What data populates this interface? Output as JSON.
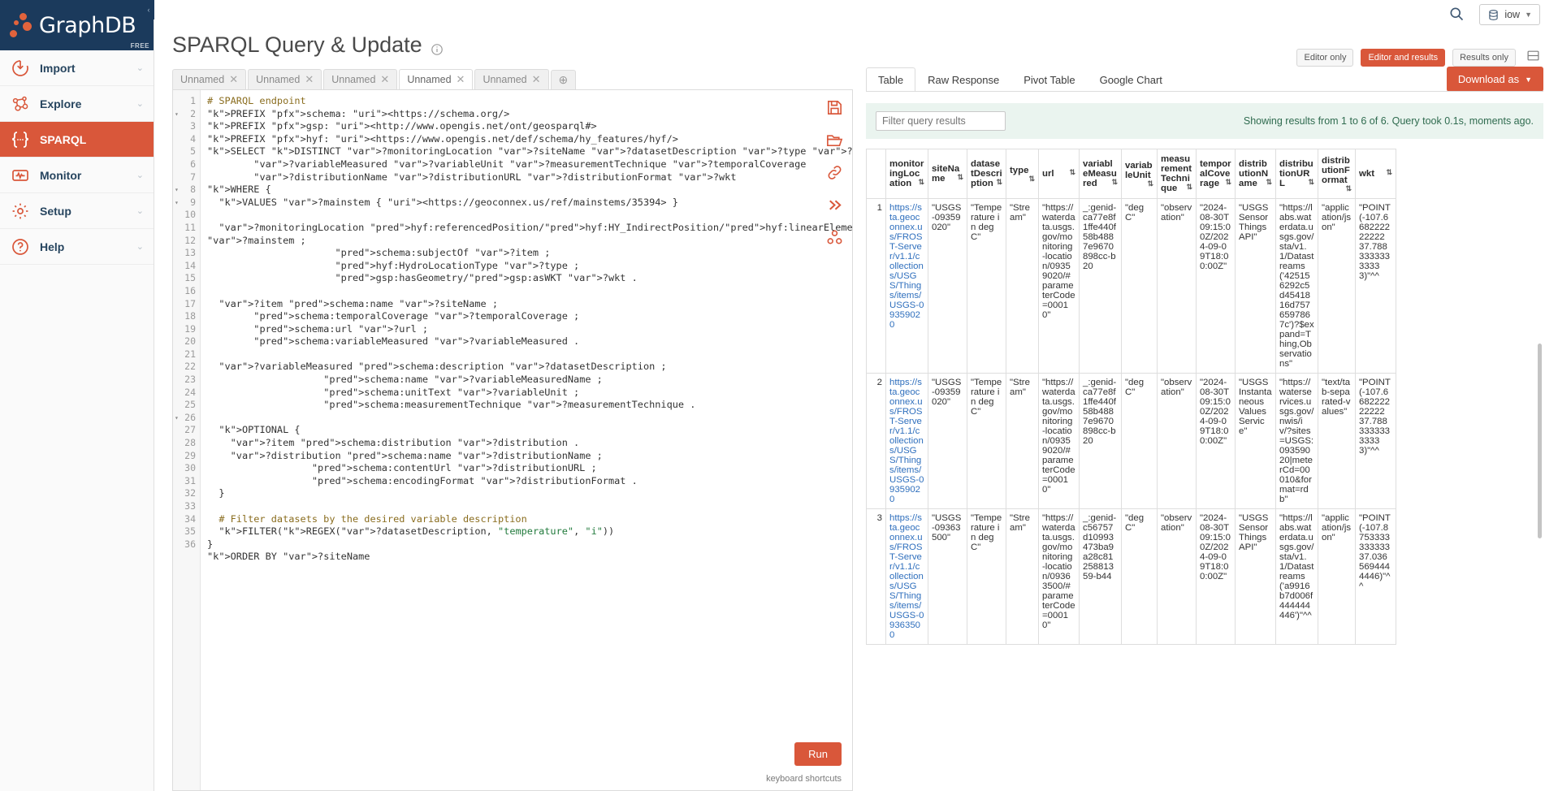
{
  "brand": {
    "name": "GraphDB",
    "edition": "FREE"
  },
  "sidebar": {
    "items": [
      {
        "label": "Import",
        "icon": "import-icon",
        "active": false
      },
      {
        "label": "Explore",
        "icon": "explore-icon",
        "active": false
      },
      {
        "label": "SPARQL",
        "icon": "sparql-icon",
        "active": true
      },
      {
        "label": "Monitor",
        "icon": "monitor-icon",
        "active": false
      },
      {
        "label": "Setup",
        "icon": "setup-icon",
        "active": false
      },
      {
        "label": "Help",
        "icon": "help-icon",
        "active": false
      }
    ]
  },
  "topbar": {
    "search_icon": "search-icon",
    "repository": "iow",
    "repo_icon": "database-icon",
    "repo_caret": "chevron-down-icon"
  },
  "page": {
    "title": "SPARQL Query & Update",
    "info_icon": "info-icon",
    "view_modes": [
      {
        "label": "Editor only",
        "selected": false
      },
      {
        "label": "Editor and results",
        "selected": true
      },
      {
        "label": "Results only",
        "selected": false
      }
    ],
    "layout_toggle_icon": "split-layout-icon"
  },
  "editor": {
    "tabs": [
      {
        "label": "Unnamed",
        "active": false
      },
      {
        "label": "Unnamed",
        "active": false
      },
      {
        "label": "Unnamed",
        "active": false
      },
      {
        "label": "Unnamed",
        "active": true
      },
      {
        "label": "Unnamed",
        "active": false
      }
    ],
    "add_tab_icon": "plus-circle-icon",
    "tools": [
      {
        "icon": "save-icon"
      },
      {
        "icon": "open-folder-icon"
      },
      {
        "icon": "link-icon"
      },
      {
        "icon": "double-chevron-right-icon"
      },
      {
        "icon": "graph-explore-icon"
      }
    ],
    "run_label": "Run",
    "keyboard_shortcuts_label": "keyboard shortcuts",
    "line_count": 36,
    "folded_lines": [
      2,
      8,
      9,
      26
    ],
    "query_lines": [
      "# SPARQL endpoint",
      "PREFIX schema: <https://schema.org/>",
      "PREFIX gsp: <http://www.opengis.net/ont/geosparql#>",
      "PREFIX hyf: <https://www.opengis.net/def/schema/hy_features/hyf/>",
      "SELECT DISTINCT ?monitoringLocation ?siteName ?datasetDescription ?type ?url",
      "        ?variableMeasured ?variableUnit ?measurementTechnique ?temporalCoverage",
      "        ?distributionName ?distributionURL ?distributionFormat ?wkt",
      "WHERE {",
      "  VALUES ?mainstem { <https://geoconnex.us/ref/mainstems/35394> }",
      "",
      "  ?monitoringLocation hyf:referencedPosition/hyf:HY_IndirectPosition/hyf:linearElement ?mainstem ;",
      "                      schema:subjectOf ?item ;",
      "                      hyf:HydroLocationType ?type ;",
      "                      gsp:hasGeometry/gsp:asWKT ?wkt .",
      "",
      "  ?item schema:name ?siteName ;",
      "        schema:temporalCoverage ?temporalCoverage ;",
      "        schema:url ?url ;",
      "        schema:variableMeasured ?variableMeasured .",
      "",
      "  ?variableMeasured schema:description ?datasetDescription ;",
      "                    schema:name ?variableMeasuredName ;",
      "                    schema:unitText ?variableUnit ;",
      "                    schema:measurementTechnique ?measurementTechnique .",
      "",
      "  OPTIONAL {",
      "    ?item schema:distribution ?distribution .",
      "    ?distribution schema:name ?distributionName ;",
      "                  schema:contentUrl ?distributionURL ;",
      "                  schema:encodingFormat ?distributionFormat .",
      "  }",
      "",
      "  # Filter datasets by the desired variable description",
      "  FILTER(REGEX(?datasetDescription, \"temperature\", \"i\"))",
      "}",
      "ORDER BY ?siteName"
    ]
  },
  "results": {
    "tabs": [
      {
        "label": "Table",
        "active": true
      },
      {
        "label": "Raw Response",
        "active": false
      },
      {
        "label": "Pivot Table",
        "active": false
      },
      {
        "label": "Google Chart",
        "active": false
      }
    ],
    "download_label": "Download as",
    "download_caret": "chevron-down-icon",
    "filter_placeholder": "Filter query results",
    "filter_value": "",
    "status": "Showing results from 1 to 6 of 6. Query took 0.1s, moments ago.",
    "columns": [
      "monitoringLocation",
      "siteName",
      "datasetDescription",
      "type",
      "url",
      "variableMeasured",
      "variableUnit",
      "measurementTechnique",
      "temporalCoverage",
      "distributionName",
      "distributionURL",
      "distributionFormat",
      "wkt"
    ],
    "sort_icon": "sort-updown-icon",
    "rows": [
      {
        "index": "1",
        "monitoringLocation": "https://sta.geoconnex.us/FROST-Server/v1.1/collections/USGS/Things/items/USGS-09359020",
        "siteName": "\"USGS-09359020\"",
        "datasetDescription": "\"Temperature in degC\"",
        "type": "\"Stream\"",
        "url": "\"https://waterdata.usgs.gov/monitoring-location/09359020/#parameterCode=00010\"",
        "variableMeasured": "_:genid-ca77e8f1ffe440f58b4887e9670898cc-b20",
        "variableUnit": "\"degC\"",
        "measurementTechnique": "\"observation\"",
        "temporalCoverage": "\"2024-08-30T09:15:00Z/2024-09-09T18:00:00Z\"",
        "distributionName": "\"USGS SensorThings API\"",
        "distributionURL": "\"https://labs.waterdata.usgs.gov/sta/v1.1/Datastreams('425156292c5d4541816d757659786 7c')?$expand=Thing,Observations\"",
        "distributionFormat": "\"application/json\"",
        "wkt": "\"POINT (-107.668222222222 37.78833333333333)\"^^<http://www.opengis.net/ont/geosparql#wktLiteral>"
      },
      {
        "index": "2",
        "monitoringLocation": "https://sta.geoconnex.us/FROST-Server/v1.1/collections/USGS/Things/items/USGS-09359020",
        "siteName": "\"USGS-09359020\"",
        "datasetDescription": "\"Temperature in degC\"",
        "type": "\"Stream\"",
        "url": "\"https://waterdata.usgs.gov/monitoring-location/09359020/#parameterCode=00010\"",
        "variableMeasured": "_:genid-ca77e8f1ffe440f58b4887e9670898cc-b20",
        "variableUnit": "\"degC\"",
        "measurementTechnique": "\"observation\"",
        "temporalCoverage": "\"2024-08-30T09:15:00Z/2024-09-09T18:00:00Z\"",
        "distributionName": "\"USGS Instantaneous Values Service\"",
        "distributionURL": "\"https://waterservices.usgs.gov/nwis/iv/?sites=USGS:09359020|meterCd=00010&format=rdb\"",
        "distributionFormat": "\"text/tab-separated-values\"",
        "wkt": "\"POINT (-107.668222222222 37.78833333333333)\"^^<http://www.opengis.net/ont/geosparql#wktLiteral>"
      },
      {
        "index": "3",
        "monitoringLocation": "https://sta.geoconnex.us/FROST-Server/v1.1/collections/USGS/Things/items/USGS-09363500",
        "siteName": "\"USGS-09363500\"",
        "datasetDescription": "\"Temperature in degC\"",
        "type": "\"Stream\"",
        "url": "\"https://waterdata.usgs.gov/monitoring-location/09363500/#parameterCode=00010\"",
        "variableMeasured": "_:genid-c56757d10993473ba9a28c8125881359-b44",
        "variableUnit": "\"degC\"",
        "measurementTechnique": "\"observation\"",
        "temporalCoverage": "\"2024-08-30T09:15:00Z/2024-09-09T18:00:00Z\"",
        "distributionName": "\"USGS SensorThings API\"",
        "distributionURL": "\"https://labs.waterdata.usgs.gov/sta/v1.1/Datastreams('a9916b7d006f444444446')\"^^<http://www.o",
        "distributionFormat": "\"application/json\"",
        "wkt": "\"POINT (-107.8753333333333 37.0365694444446)\"^^<htt"
      }
    ]
  },
  "colors": {
    "brand_navy": "#1b3a5c",
    "accent_orange": "#d9573a",
    "link_blue": "#2f6fbd",
    "status_green": "#2f6b4f",
    "filter_bg": "#eaf4ef"
  }
}
